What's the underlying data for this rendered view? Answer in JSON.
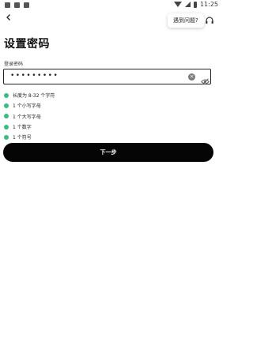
{
  "status_bar": {
    "time": "11:25"
  },
  "header": {
    "help_text": "遇到问题?"
  },
  "page": {
    "title": "设置密码"
  },
  "password": {
    "label": "登录密码",
    "masked_value": "•••••••••"
  },
  "requirements": [
    {
      "text": "长度为 8-32 个字符",
      "met": true
    },
    {
      "text": "1 个小写字母",
      "met": true
    },
    {
      "text": "1 个大写字母",
      "met": true
    },
    {
      "text": "1 个数字",
      "met": true
    },
    {
      "text": "1 个符号",
      "met": true
    }
  ],
  "actions": {
    "next_label": "下一步"
  },
  "colors": {
    "check": "#2ec27e",
    "button": "#050505"
  }
}
